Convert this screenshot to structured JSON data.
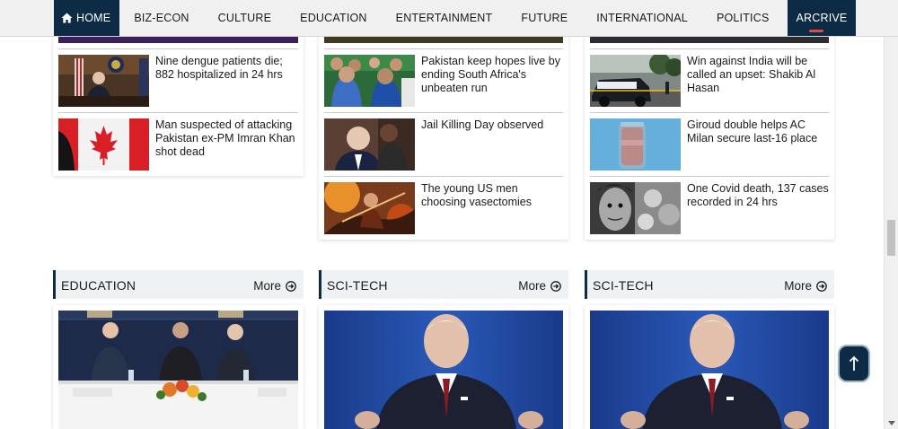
{
  "nav": {
    "home": "HOME",
    "items": [
      "BIZ-ECON",
      "CULTURE",
      "EDUCATION",
      "ENTERTAINMENT",
      "FUTURE",
      "INTERNATIONAL",
      "POLITICS"
    ],
    "active": "ARCRIVE"
  },
  "columns": [
    {
      "stories": [
        {
          "title": "Nine dengue patients die; 882 hospitalized in 24 hrs"
        },
        {
          "title": "Man suspected of attacking Pakistan ex-PM Imran Khan shot dead"
        }
      ]
    },
    {
      "stories": [
        {
          "title": "Pakistan keep hopes live by ending South Africa's unbeaten run"
        },
        {
          "title": "Jail Killing Day observed"
        },
        {
          "title": "The young US men choosing vasectomies"
        }
      ]
    },
    {
      "stories": [
        {
          "title": "Win against India will be called an upset: Shakib Al Hasan"
        },
        {
          "title": "Giroud double helps AC Milan secure last-16 place"
        },
        {
          "title": "One Covid death, 137 cases recorded in 24 hrs"
        }
      ]
    }
  ],
  "sections": [
    {
      "name": "EDUCATION",
      "more": "More"
    },
    {
      "name": "SCI-TECH",
      "more": "More"
    },
    {
      "name": "SCI-TECH",
      "more": "More"
    }
  ],
  "colors": {
    "navy": "#0d2b44",
    "accent_red": "#e24a4a",
    "section_bg": "#eff2f4"
  }
}
